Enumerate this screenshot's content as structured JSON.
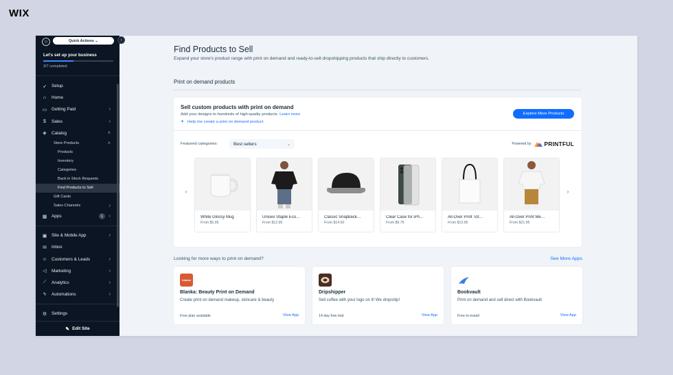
{
  "brand": {
    "logo_text": "WIX"
  },
  "sidebar": {
    "quick_actions": "Quick Actions",
    "setup_title": "Let's set up your business",
    "setup_progress": 0.43,
    "setup_count": "3/7 completed",
    "nav": [
      {
        "label": "Setup",
        "icon": "rocket-icon"
      },
      {
        "label": "Home",
        "icon": "home-icon"
      },
      {
        "label": "Getting Paid",
        "icon": "wallet-icon"
      },
      {
        "label": "Sales",
        "icon": "dollar-icon"
      },
      {
        "label": "Catalog",
        "icon": "catalog-icon"
      }
    ],
    "catalog_sub": {
      "store_products": "Store Products",
      "items": [
        "Products",
        "Inventory",
        "Categories",
        "Back in Stock Requests",
        "Find Products to Sell"
      ],
      "gift_cards": "Gift Cards",
      "sales_channels": "Sales Channels"
    },
    "apps": {
      "label": "Apps",
      "badge": "1"
    },
    "nav2": [
      {
        "label": "Site & Mobile App",
        "icon": "site-icon"
      },
      {
        "label": "Inbox",
        "icon": "inbox-icon"
      },
      {
        "label": "Customers & Leads",
        "icon": "people-icon"
      },
      {
        "label": "Marketing",
        "icon": "megaphone-icon"
      },
      {
        "label": "Analytics",
        "icon": "analytics-icon"
      },
      {
        "label": "Automations",
        "icon": "automation-icon"
      }
    ],
    "settings": "Settings",
    "edit_site": "Edit Site"
  },
  "main": {
    "title": "Find Products to Sell",
    "subtitle": "Expand your store's product range with print on demand and ready-to-sell dropshipping products that ship directly to customers.",
    "section_title": "Print on demand products",
    "pod": {
      "title": "Sell custom products with print on demand",
      "desc": "Add your designs to hundreds of high-quality products.",
      "learn_more": "Learn more",
      "help": "Help me create a print on demand product",
      "explore_button": "Explore More Products",
      "featured_label": "Featured categories:",
      "featured_value": "Best sellers",
      "powered_by": "Powered by",
      "printful": "PRINTFUL"
    },
    "products": [
      {
        "name": "White Glossy Mug",
        "price": "From $5.95"
      },
      {
        "name": "Unisex Staple Eco…",
        "price": "From $12.95"
      },
      {
        "name": "Classic Snapback…",
        "price": "From $14.50"
      },
      {
        "name": "Clear Case for iPh…",
        "price": "From $9.75"
      },
      {
        "name": "All-Over Print Tot…",
        "price": "From $13.95"
      },
      {
        "name": "All-Over Print Me…",
        "price": "From $21.95"
      }
    ],
    "more_title": "Looking for more ways to print on demand?",
    "see_more": "See More Apps",
    "apps": [
      {
        "name": "Blanka: Beauty Print on Demand",
        "desc": "Create print on demand makeup, skincare & beauty",
        "price": "Free plan available",
        "view": "View App",
        "logo_text": "blanka",
        "color": "#d85a35"
      },
      {
        "name": "Dripshipper",
        "desc": "Sell coffee with your logo on it! We dropship!",
        "price": "14 day free trial",
        "view": "View App",
        "color": "#4a2e22"
      },
      {
        "name": "Bookvault",
        "desc": "Print on demand and sell direct with Bookvault",
        "price": "Free to install",
        "view": "View App",
        "color": "#3b7be0"
      }
    ]
  },
  "colors": {
    "accent": "#116dff",
    "sidebar_bg": "#0b1523",
    "page_bg": "#f0f3f7",
    "outer_bg": "#d2d5e3"
  }
}
